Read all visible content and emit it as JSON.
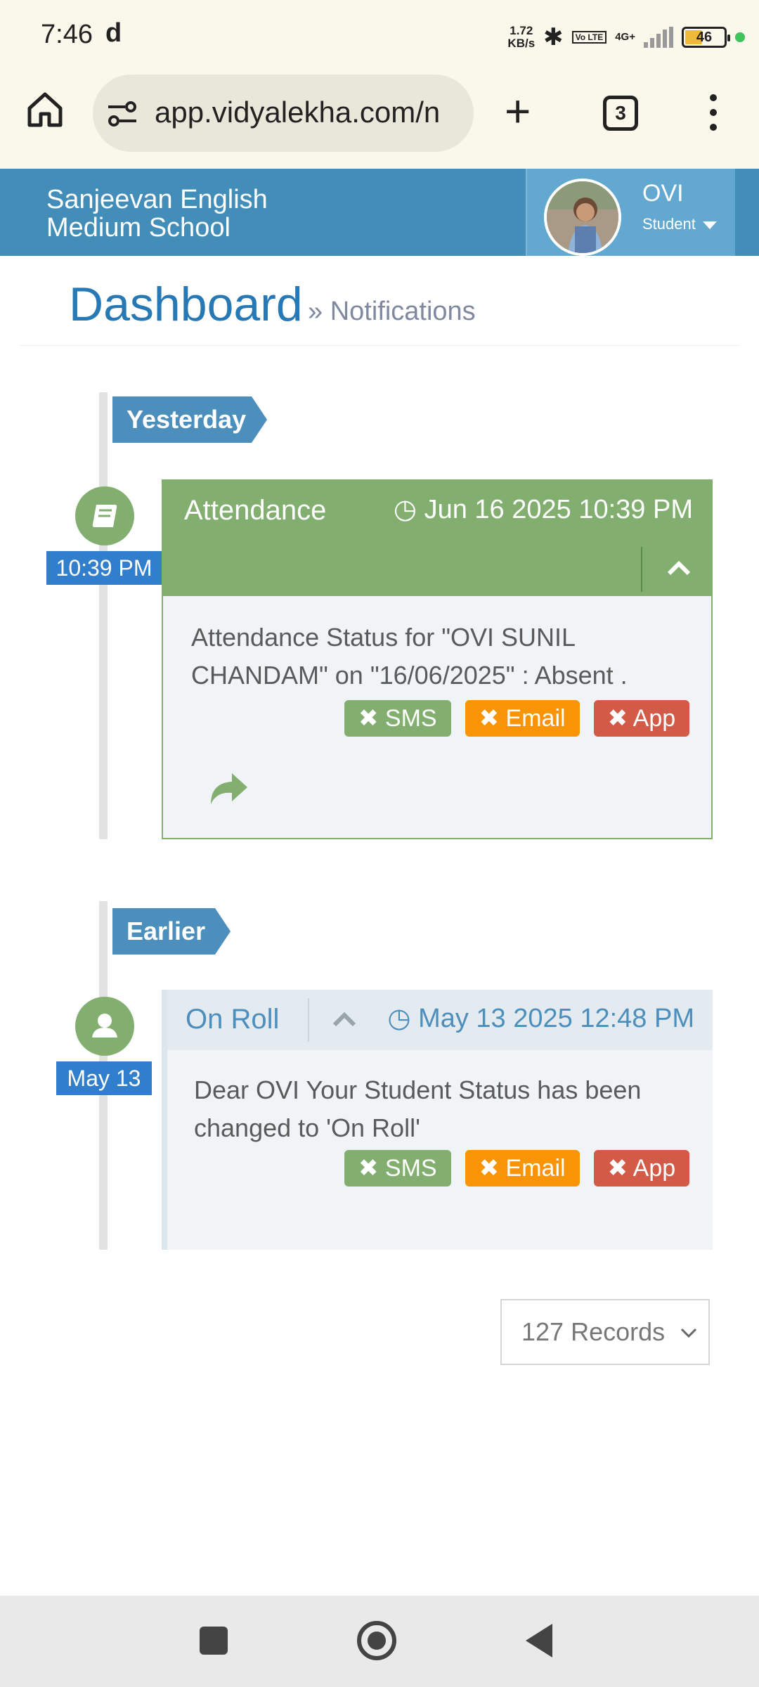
{
  "status_bar": {
    "time": "7:46",
    "notification_glyph": "d",
    "net_speed_value": "1.72",
    "net_speed_unit": "KB/s",
    "volte": "Vo LTE",
    "network": "4G+",
    "battery": "46",
    "colors": {
      "battery_fill": "#f0b93a",
      "dot": "#3ec45b"
    }
  },
  "browser": {
    "url": "app.vidyalekha.com/n",
    "tab_count": "3",
    "icons": [
      "home-icon",
      "site-settings-icon",
      "new-tab-icon",
      "tabs-icon",
      "more-menu-icon"
    ]
  },
  "header": {
    "school_name": "Sanjeevan English Medium School",
    "user_name": "OVI",
    "user_role": "Student",
    "colors": {
      "header_bg": "#438eb9",
      "user_box_bg": "#62a8d1"
    }
  },
  "page": {
    "title": "Dashboard",
    "separator": "»",
    "subtitle": "Notifications"
  },
  "timeline": {
    "groups": [
      {
        "label": "Yesterday",
        "items": [
          {
            "time_label": "10:39 PM",
            "icon": "book-icon",
            "title": "Attendance",
            "date": "Jun 16 2025 10:39 PM",
            "message": "Attendance Status for \"OVI SUNIL CHANDAM\" on \"16/06/2025\" : Absent .",
            "badges": [
              "✖ SMS",
              "✖ Email",
              "✖ App"
            ]
          }
        ]
      },
      {
        "label": "Earlier",
        "items": [
          {
            "time_label": "May 13",
            "icon": "user-icon",
            "title": "On Roll",
            "date": "May 13 2025 12:48 PM",
            "message": "Dear OVI Your Student Status has been changed to 'On Roll'",
            "badges": [
              "✖ SMS",
              "✖ Email",
              "✖ App"
            ]
          }
        ]
      }
    ],
    "colors": {
      "success": "#82af6f",
      "warning": "#f89406",
      "danger": "#d15b47",
      "primary": "#4c8fbd"
    }
  },
  "records": {
    "selected": "127 Records"
  }
}
